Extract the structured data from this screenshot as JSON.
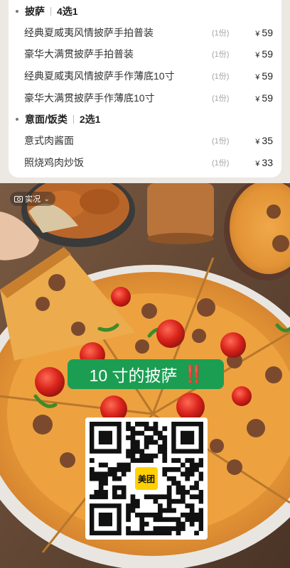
{
  "menu": {
    "sections": [
      {
        "title": "披萨",
        "rule": "4选1",
        "items": [
          {
            "name": "经典夏威夷风情披萨手拍普装",
            "qty": "(1份)",
            "currency": "¥",
            "price": "59"
          },
          {
            "name": "豪华大满贯披萨手拍普装",
            "qty": "(1份)",
            "currency": "¥",
            "price": "59"
          },
          {
            "name": "经典夏威夷风情披萨手作薄底10寸",
            "qty": "(1份)",
            "currency": "¥",
            "price": "59"
          },
          {
            "name": "豪华大满贯披萨手作薄底10寸",
            "qty": "(1份)",
            "currency": "¥",
            "price": "59"
          }
        ]
      },
      {
        "title": "意面/饭类",
        "rule": "2选1",
        "items": [
          {
            "name": "意式肉酱面",
            "qty": "(1份)",
            "currency": "¥",
            "price": "35"
          },
          {
            "name": "照烧鸡肉炒饭",
            "qty": "(1份)",
            "currency": "¥",
            "price": "33"
          }
        ]
      }
    ]
  },
  "photo": {
    "tag_label": "实况",
    "banner_text": "10 寸的披萨",
    "banner_emphasis": "‼️",
    "qr_logo_text": "美团"
  },
  "colors": {
    "banner_green": "#1b9e52",
    "logo_yellow": "#ffd100",
    "emphasis_red": "#e0201c"
  }
}
